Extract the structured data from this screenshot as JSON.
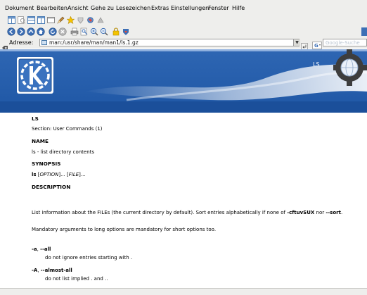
{
  "menubar": {
    "items": [
      "Dokument",
      "Bearbeiten",
      "Ansicht",
      "Gehe zu",
      "Lesezeichen",
      "Extras",
      "Einstellungen",
      "Fenster",
      "Hilfe"
    ]
  },
  "address": {
    "label": "Adresse:",
    "url": "man:/usr/share/man/man1/ls.1.gz",
    "search_placeholder": "Google-Suche"
  },
  "banner": {
    "title": "LS"
  },
  "doc": {
    "title": "LS",
    "section": "Section: User Commands (1)",
    "name_heading": "NAME",
    "name_text": "ls - list directory contents",
    "synopsis_heading": "SYNOPSIS",
    "synopsis_cmd": "ls",
    "synopsis_sp1": " [",
    "synopsis_opt": "OPTION",
    "synopsis_mid": "]... [",
    "synopsis_file": "FILE",
    "synopsis_end": "]...",
    "description_heading": "DESCRIPTION",
    "desc_p1_a": "List information about the FILEs (the current directory by default). Sort entries alphabetically if none of ",
    "desc_p1_b": "-cftuvSUX",
    "desc_p1_c": " nor ",
    "desc_p1_d": "--sort",
    "desc_p1_e": ".",
    "desc_p2": "Mandatory arguments to long options are mandatory for short options too.",
    "opt_a_short": "-a",
    "opt_a_sep": ", ",
    "opt_a_long": "--all",
    "opt_a_desc": "do not ignore entries starting with .",
    "opt_A_short": "-A",
    "opt_A_sep": ", ",
    "opt_A_long": "--almost-all",
    "opt_A_desc": "do not list implied . and .."
  },
  "colors": {
    "banner_blue": "#2c5fa8",
    "banner_dark": "#1d4c93",
    "chrome": "#eeeeec"
  },
  "icons": {
    "toolbar1": [
      "view-split-icon",
      "find-icon",
      "tile-horizontal-icon",
      "tile-vertical-icon",
      "window-icon",
      "pen-icon",
      "bookmark-star-icon",
      "shield-icon",
      "tools-icon",
      "clear-icon"
    ],
    "toolbar2": [
      "back-icon",
      "forward-icon",
      "up-icon",
      "home-icon",
      "reload-icon",
      "stop-icon",
      "print-icon",
      "print-frame-icon",
      "zoom-in-icon",
      "zoom-out-icon",
      "lock-icon",
      "save-icon"
    ]
  }
}
